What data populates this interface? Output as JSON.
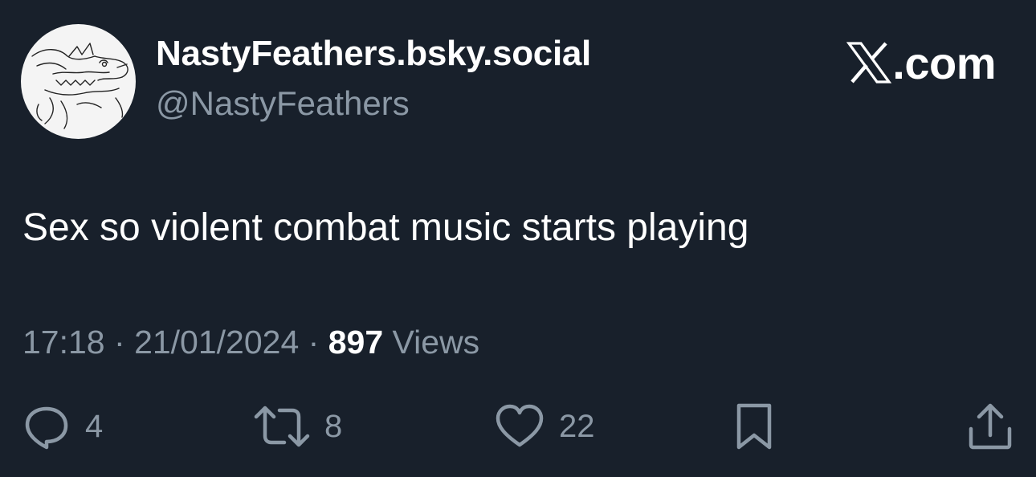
{
  "tweet": {
    "display_name": "NastyFeathers.bsky.social",
    "handle": "@NastyFeathers",
    "text": "Sex so violent combat music starts playing",
    "time": "17:18",
    "separator": "·",
    "date": "21/01/2024",
    "views_count": "897",
    "views_label": "Views"
  },
  "brand": {
    "text": ".com",
    "icon": "x-logo-icon"
  },
  "actions": {
    "reply": {
      "icon": "reply-icon",
      "count": "4"
    },
    "retweet": {
      "icon": "retweet-icon",
      "count": "8"
    },
    "like": {
      "icon": "heart-icon",
      "count": "22"
    },
    "bookmark": {
      "icon": "bookmark-icon"
    },
    "share": {
      "icon": "share-icon"
    }
  },
  "colors": {
    "background": "#18202b",
    "primary_text": "#ffffff",
    "secondary_text": "#8b98a5"
  }
}
